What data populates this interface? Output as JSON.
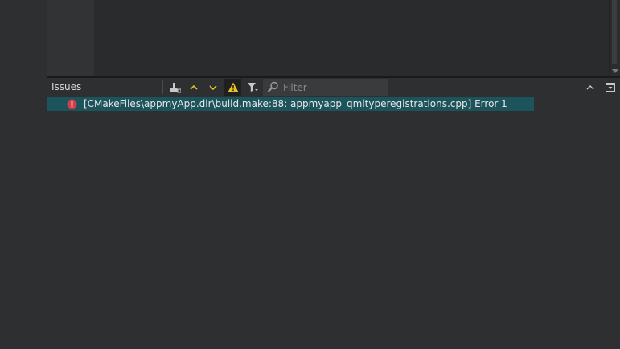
{
  "issues_panel": {
    "title": "Issues",
    "filter": {
      "placeholder": "Filter",
      "value": ""
    },
    "toolbar_icons": {
      "clean": "broom-icon",
      "prev": "chevron-up-icon",
      "next": "chevron-down-icon",
      "warnings_toggle": "warning-triangle-icon",
      "filter_menu": "filter-funnel-icon",
      "search": "magnifier-icon",
      "collapse": "chevron-up-icon",
      "close_pane": "pane-close-icon"
    },
    "issues": [
      {
        "severity": "error",
        "icon": "error-circle-icon",
        "text": "[CMakeFiles\\appmyApp.dir\\build.make:88: appmyapp_qmltyperegistrations.cpp] Error 1"
      }
    ]
  },
  "colors": {
    "background": "#2e2f30",
    "selected_row": "#1d545c",
    "error_icon": "#d0404a",
    "accent_yellow": "#e6c229"
  }
}
